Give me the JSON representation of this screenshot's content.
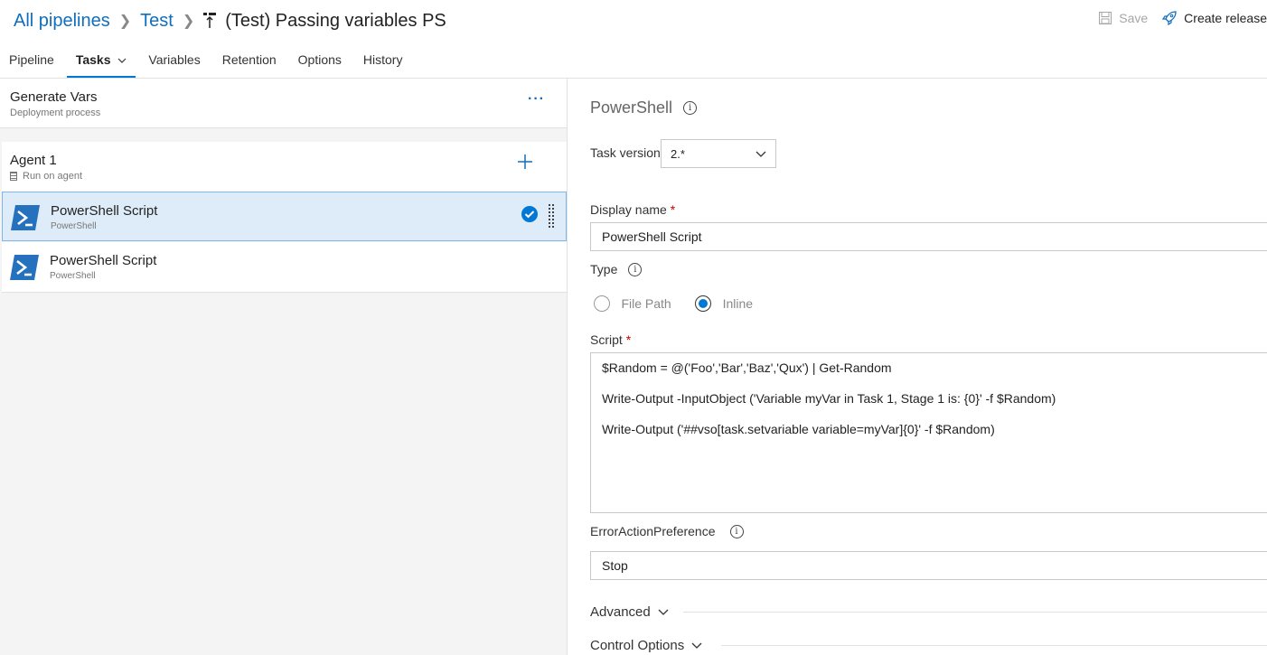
{
  "breadcrumb": {
    "all_pipelines": "All pipelines",
    "folder": "Test",
    "title": "(Test) Passing variables PS"
  },
  "actions": {
    "save": "Save",
    "create_release": "Create release"
  },
  "tabs": [
    {
      "label": "Pipeline"
    },
    {
      "label": "Tasks"
    },
    {
      "label": "Variables"
    },
    {
      "label": "Retention"
    },
    {
      "label": "Options"
    },
    {
      "label": "History"
    }
  ],
  "stage": {
    "name": "Generate Vars",
    "subtitle": "Deployment process",
    "more": "···"
  },
  "agent": {
    "name": "Agent 1",
    "subtitle": "Run on agent"
  },
  "tasks": [
    {
      "name": "PowerShell Script",
      "type": "PowerShell",
      "selected": true
    },
    {
      "name": "PowerShell Script",
      "type": "PowerShell",
      "selected": false
    }
  ],
  "detail": {
    "title": "PowerShell",
    "task_version_label": "Task version",
    "task_version": "2.*",
    "display_name_label": "Display name",
    "display_name": "PowerShell Script",
    "type_label": "Type",
    "type_options": [
      "File Path",
      "Inline"
    ],
    "type_selected": "Inline",
    "script_label": "Script",
    "script_lines": [
      "$Random = @('Foo','Bar','Baz','Qux') | Get-Random",
      "Write-Output -InputObject ('Variable myVar in Task 1, Stage 1 is: {0}' -f $Random)",
      "Write-Output ('##vso[task.setvariable variable=myVar]{0}' -f $Random)"
    ],
    "error_pref_label": "ErrorActionPreference",
    "error_pref": "Stop",
    "advanced": "Advanced",
    "control_options": "Control Options",
    "required_mark": "*",
    "info_glyph": "i"
  },
  "colors": {
    "accent": "#0078d4",
    "link": "#106ebe",
    "selected_bg": "#deecf9"
  }
}
